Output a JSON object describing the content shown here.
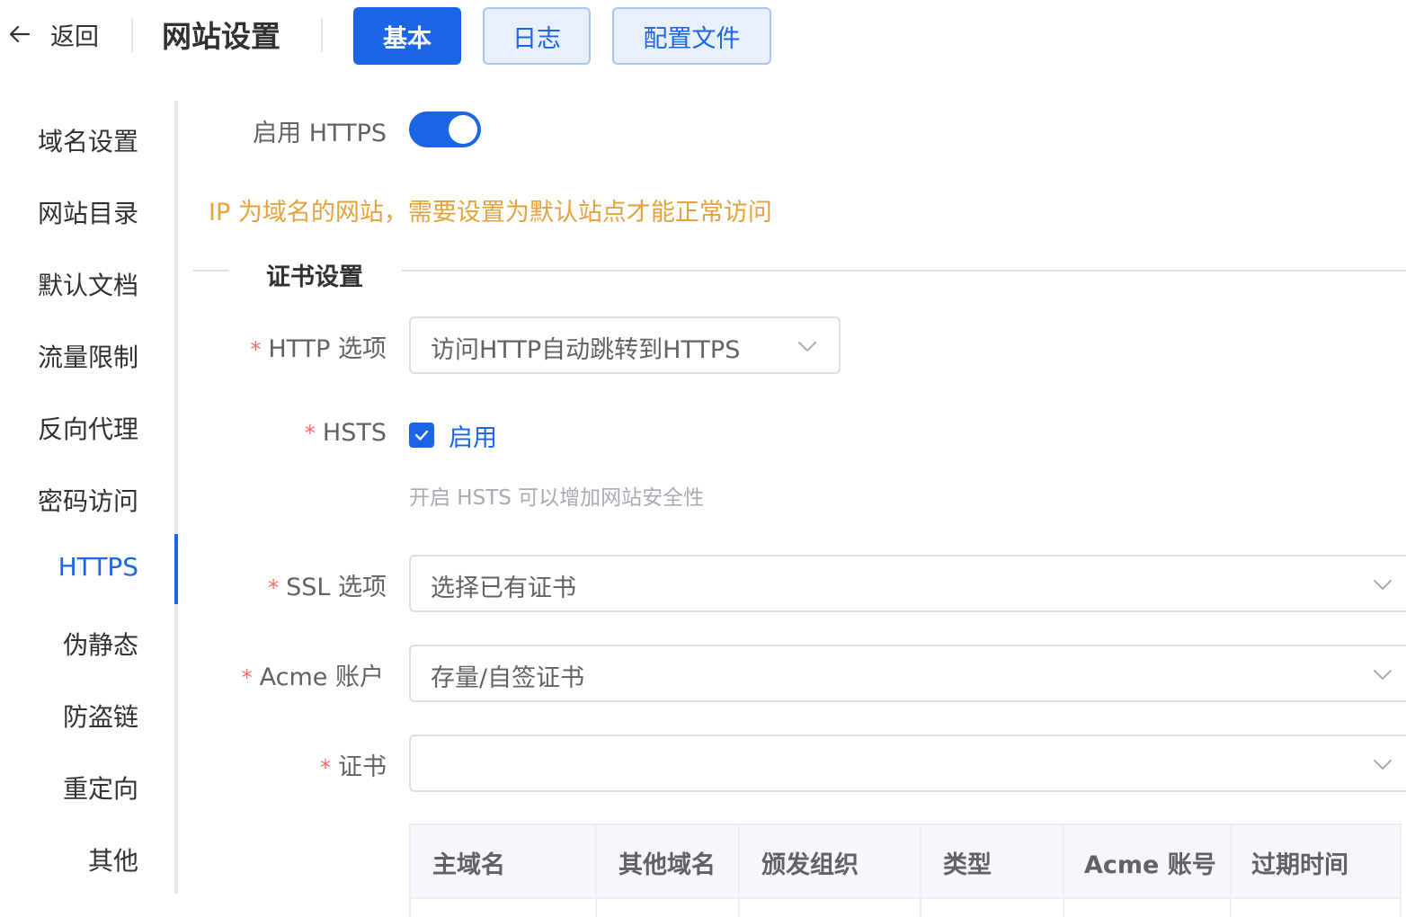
{
  "header": {
    "back_label": "返回",
    "title": "网站设置",
    "tabs": [
      {
        "label": "基本",
        "active": true
      },
      {
        "label": "日志",
        "active": false
      },
      {
        "label": "配置文件",
        "active": false
      }
    ]
  },
  "sidenav": {
    "items": [
      {
        "label": "域名设置"
      },
      {
        "label": "网站目录"
      },
      {
        "label": "默认文档"
      },
      {
        "label": "流量限制"
      },
      {
        "label": "反向代理"
      },
      {
        "label": "密码访问"
      },
      {
        "label": "HTTPS",
        "active": true
      },
      {
        "label": "伪静态"
      },
      {
        "label": "防盗链"
      },
      {
        "label": "重定向"
      },
      {
        "label": "其他"
      }
    ]
  },
  "form": {
    "https_label": "启用 HTTPS",
    "https_enabled": true,
    "warning": "IP 为域名的网站，需要设置为默认站点才能正常访问",
    "section_title": "证书设置",
    "http_option": {
      "label": "HTTP 选项",
      "value": "访问HTTP自动跳转到HTTPS"
    },
    "hsts": {
      "label": "HSTS",
      "checkbox_label": "启用",
      "checked": true,
      "hint": "开启 HSTS 可以增加网站安全性"
    },
    "ssl_option": {
      "label": "SSL 选项",
      "value": "选择已有证书"
    },
    "acme_account": {
      "label": "Acme 账户",
      "value": "存量/自签证书"
    },
    "certificate": {
      "label": "证书",
      "value": ""
    },
    "required_mark": "*"
  },
  "table": {
    "columns": [
      "主域名",
      "其他域名",
      "颁发组织",
      "类型",
      "Acme 账号",
      "过期时间"
    ]
  },
  "colors": {
    "primary": "#1a66e6",
    "warning": "#e6a23c",
    "required": "#f56c6c"
  }
}
